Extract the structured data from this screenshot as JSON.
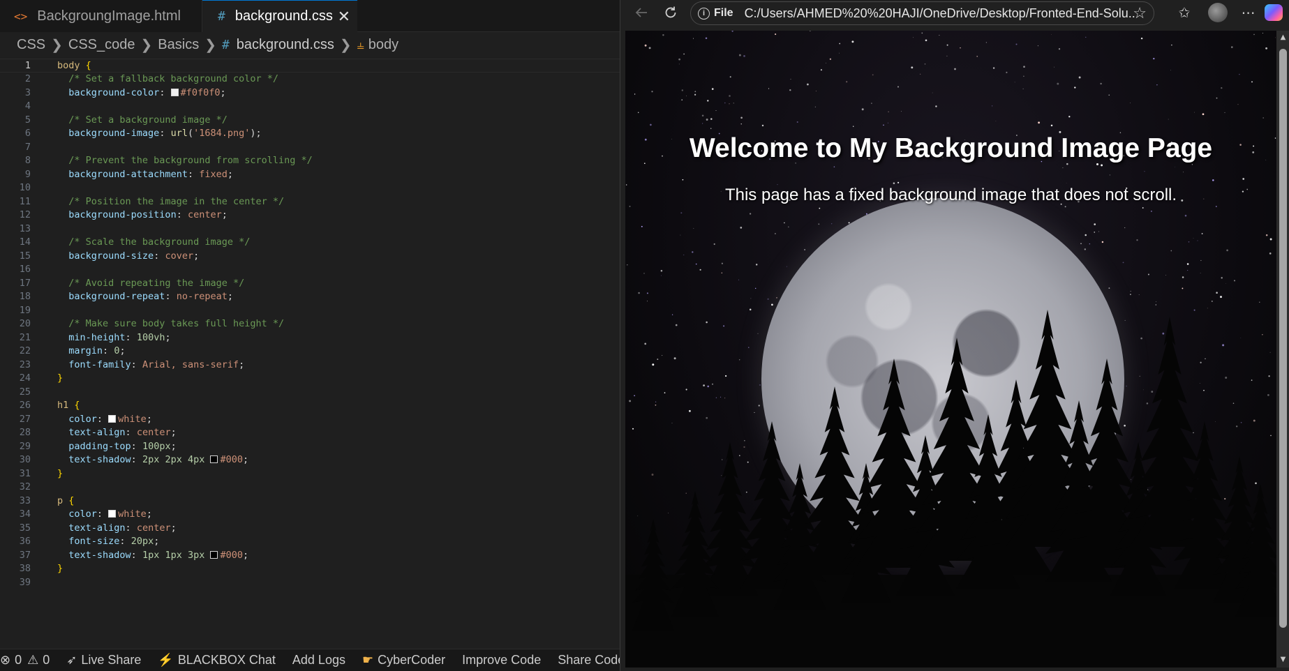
{
  "editor": {
    "tabs": [
      {
        "icon": "<>",
        "label": "BackgroungImage.html"
      },
      {
        "icon": "#",
        "label": "background.css",
        "close": "✕"
      }
    ],
    "breadcrumb": [
      "CSS",
      "CSS_code",
      "Basics",
      "background.css",
      "body"
    ],
    "code_lines": [
      "body {",
      "  /* Set a fallback background color */",
      "  background-color: #f0f0f0;",
      "",
      "  /* Set a background image */",
      "  background-image: url('1684.png');",
      "",
      "  /* Prevent the background from scrolling */",
      "  background-attachment: fixed;",
      "",
      "  /* Position the image in the center */",
      "  background-position: center;",
      "",
      "  /* Scale the background image */",
      "  background-size: cover;",
      "",
      "  /* Avoid repeating the image */",
      "  background-repeat: no-repeat;",
      "",
      "  /* Make sure body takes full height */",
      "  min-height: 100vh;",
      "  margin: 0;",
      "  font-family: Arial, sans-serif;",
      "}",
      "",
      "h1 {",
      "  color: white;",
      "  text-align: center;",
      "  padding-top: 100px;",
      "  text-shadow: 2px 2px 4px #000;",
      "}",
      "",
      "p {",
      "  color: white;",
      "  text-align: center;",
      "  font-size: 20px;",
      "  text-shadow: 1px 1px 3px #000;",
      "}",
      ""
    ],
    "active_line": 1,
    "status": {
      "errors": "0",
      "warnings": "0",
      "items": [
        "Live Share",
        "BLACKBOX Chat",
        "Add Logs",
        "CyberCoder",
        "Improve Code",
        "Share Code Link"
      ]
    }
  },
  "browser": {
    "file_label": "File",
    "url": "C:/Users/AHMED%20%20HAJI/OneDrive/Desktop/Fronted-End-Solu...",
    "page": {
      "h1": "Welcome to My Background Image Page",
      "p": "This page has a fixed background image that does not scroll."
    }
  },
  "colors": {
    "editor_bg": "#1f1f1f",
    "property": "#9cdcfe",
    "value": "#ce9178",
    "comment": "#6a9955",
    "selector": "#d7ba7d",
    "accent": "#0078d4"
  }
}
